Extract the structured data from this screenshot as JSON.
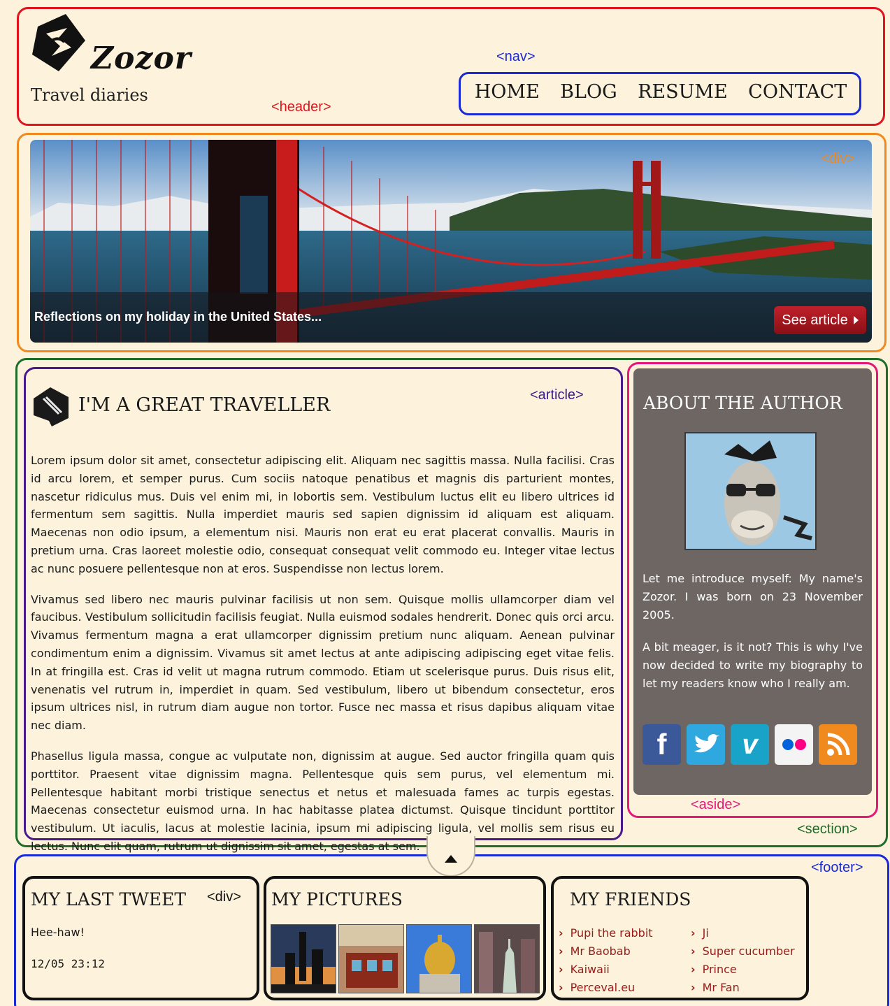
{
  "header": {
    "site_name": "Zozor",
    "tagline": "Travel diaries",
    "annotation": "<header>"
  },
  "nav": {
    "annotation": "<nav>",
    "items": [
      "HOME",
      "BLOG",
      "RESUME",
      "CONTACT"
    ]
  },
  "banner": {
    "annotation": "<div>",
    "caption": "Reflections on my holiday in the United States...",
    "button_label": "See article"
  },
  "section": {
    "annotation": "<section>"
  },
  "article": {
    "annotation": "<article>",
    "title": "I'M A GREAT TRAVELLER",
    "paragraphs": [
      "Lorem ipsum dolor sit amet, consectetur adipiscing elit. Aliquam nec sagittis massa. Nulla facilisi. Cras id arcu lorem, et semper purus. Cum sociis natoque penatibus et magnis dis parturient montes, nascetur ridiculus mus. Duis vel enim mi, in lobortis sem. Vestibulum luctus elit eu libero ultrices id fermentum sem sagittis. Nulla imperdiet mauris sed sapien dignissim id aliquam est aliquam. Maecenas non odio ipsum, a elementum nisi. Mauris non erat eu erat placerat convallis. Mauris in pretium urna. Cras laoreet molestie odio, consequat consequat velit commodo eu. Integer vitae lectus ac nunc posuere pellentesque non at eros. Suspendisse non lectus lorem.",
      "Vivamus sed libero nec mauris pulvinar facilisis ut non sem. Quisque mollis ullamcorper diam vel faucibus. Vestibulum sollicitudin facilisis feugiat. Nulla euismod sodales hendrerit. Donec quis orci arcu. Vivamus fermentum magna a erat ullamcorper dignissim pretium nunc aliquam. Aenean pulvinar condimentum enim a dignissim. Vivamus sit amet lectus at ante adipiscing adipiscing eget vitae felis. In at fringilla est. Cras id velit ut magna rutrum commodo. Etiam ut scelerisque purus. Duis risus elit, venenatis vel rutrum in, imperdiet in quam. Sed vestibulum, libero ut bibendum consectetur, eros ipsum ultrices nisl, in rutrum diam augue non tortor. Fusce nec massa et risus dapibus aliquam vitae nec diam.",
      "Phasellus ligula massa, congue ac vulputate non, dignissim at augue. Sed auctor fringilla quam quis porttitor. Praesent vitae dignissim magna. Pellentesque quis sem purus, vel elementum mi. Pellentesque habitant morbi tristique senectus et netus et malesuada fames ac turpis egestas. Maecenas consectetur euismod urna. In hac habitasse platea dictumst. Quisque tincidunt porttitor vestibulum. Ut iaculis, lacus at molestie lacinia, ipsum mi adipiscing ligula, vel mollis sem risus eu lectus. Nunc elit quam, rutrum ut dignissim sit amet, egestas at sem."
    ]
  },
  "aside": {
    "annotation": "<aside>",
    "title": "ABOUT THE AUTHOR",
    "paragraphs": [
      "Let me introduce myself: My name's Zozor. I was born on 23 November 2005.",
      "A bit meager, is it not? This is why I've now decided to write my biography to let my readers know who I really am."
    ],
    "socials": [
      {
        "icon": "facebook-icon",
        "glyph": "f",
        "color": "#3b5998"
      },
      {
        "icon": "twitter-icon",
        "glyph": "",
        "color": "#2fa8e0"
      },
      {
        "icon": "vimeo-icon",
        "glyph": "v",
        "color": "#1aa3c8"
      },
      {
        "icon": "flickr-icon",
        "glyph": "",
        "color": "#f4f4f4"
      },
      {
        "icon": "rss-icon",
        "glyph": "",
        "color": "#f08a1e"
      }
    ]
  },
  "footer": {
    "annotation": "<footer>",
    "tweet": {
      "annotation": "<div>",
      "title": "MY LAST TWEET",
      "text": "Hee-haw!",
      "time": "12/05 23:12"
    },
    "pictures": {
      "title": "MY PICTURES"
    },
    "friends": {
      "title": "MY FRIENDS",
      "col1": [
        "Pupi the rabbit",
        "Mr Baobab",
        "Kaiwaii",
        "Perceval.eu"
      ],
      "col2": [
        "Ji",
        "Super cucumber",
        "Prince",
        "Mr Fan"
      ]
    }
  },
  "colors": {
    "header_outline": "#e0141e",
    "nav_outline": "#1a2ad6",
    "banner_outline": "#f08a1e",
    "section_outline": "#1e6e2a",
    "article_outline": "#4a1a8a",
    "aside_outline": "#e3187a",
    "footer_outline": "#1a2ad6",
    "page_background": "#fdf3dc"
  }
}
